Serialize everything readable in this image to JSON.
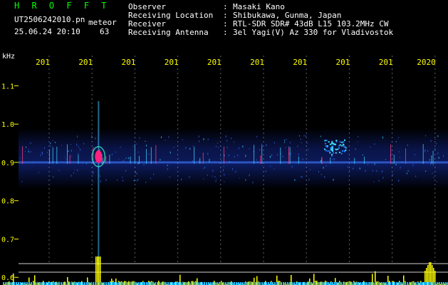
{
  "header": {
    "brand": "H R O F F T",
    "file_name": "UT2506242010.pn",
    "mode": "meteor",
    "datetime": "25.06.24 20:10",
    "count": "63",
    "rows": [
      {
        "label": "Observer",
        "colon": ":",
        "value": "Masaki Kano"
      },
      {
        "label": "Receiving Location",
        "colon": ":",
        "value": "Shibukawa, Gunma, Japan"
      },
      {
        "label": "Receiver",
        "colon": ":",
        "value": "RTL-SDR SDR# 43dB L15 103.2MHz CW"
      },
      {
        "label": "Receiving Antenna",
        "colon": ":",
        "value": "3el Yagi(V) Az 330 for Vladivostok"
      }
    ]
  },
  "colors": {
    "brand": "#00ff00",
    "text": "#ffffff",
    "axis": "#ffff00",
    "signal": "#2040c0",
    "meteor": "#ff2080"
  },
  "chart_data": {
    "type": "heatmap",
    "ylabel": "kHz",
    "y_ticks": [
      "1.1",
      "1.0",
      "0.9",
      "0.8",
      "0.7",
      "0.6"
    ],
    "x_ticks": [
      "201",
      "201",
      "201",
      "201",
      "201",
      "201",
      "201",
      "201",
      "201",
      "2020"
    ],
    "ylim": [
      0.58,
      1.19
    ],
    "meteors": [
      {
        "minute": 1.7,
        "khz": 0.915
      },
      {
        "minute": 10.2,
        "khz": 0.935
      }
    ]
  }
}
